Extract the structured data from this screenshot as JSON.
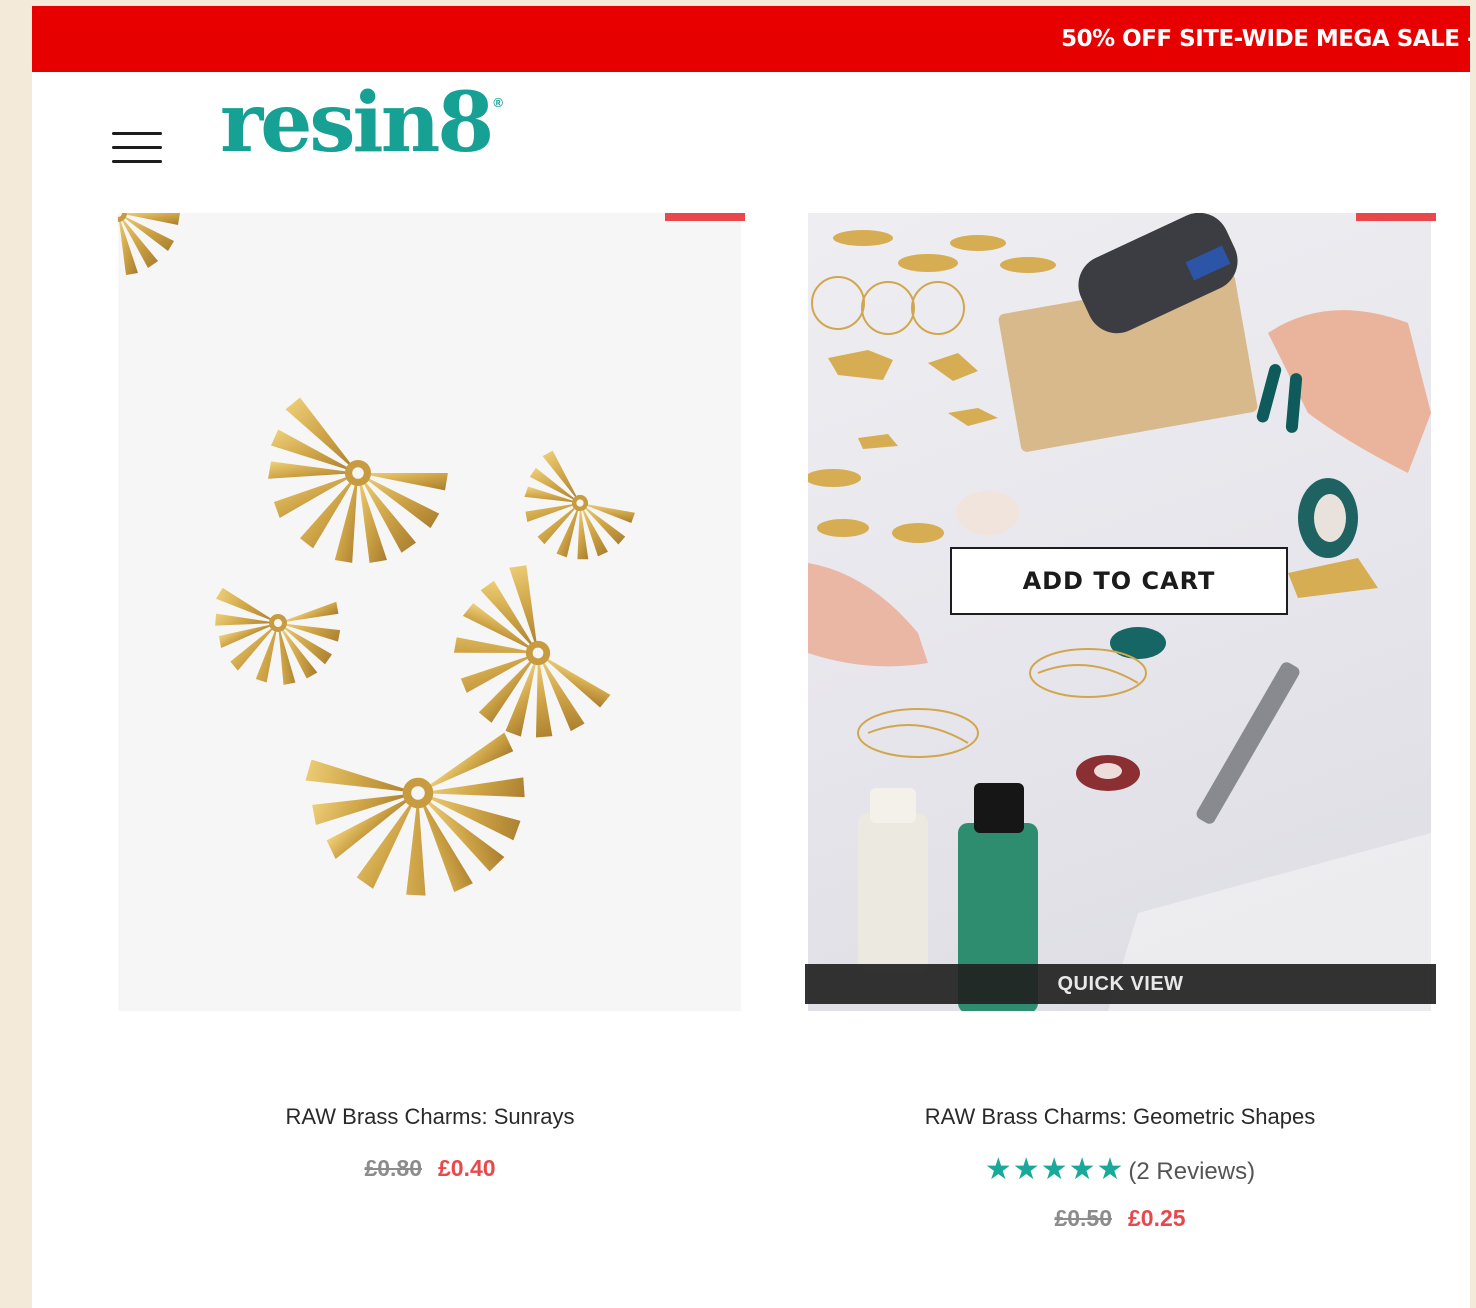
{
  "promo_bar": {
    "text": "50% OFF SITE-WIDE MEGA SALE -"
  },
  "header": {
    "logo_text": "resin8",
    "logo_mark": "®",
    "menu_icon": "hamburger-menu-icon"
  },
  "colors": {
    "promo_red": "#e60000",
    "brand_teal": "#17a195",
    "sale_red": "#e8484c",
    "star_teal": "#18a99b"
  },
  "products": [
    {
      "title": "RAW Brass Charms: Sunrays",
      "old_price": "£0.80",
      "price": "£0.40"
    },
    {
      "title": "RAW Brass Charms: Geometric Shapes",
      "rating_stars": "★★★★★",
      "rating": 5,
      "reviews_label": "(2 Reviews)",
      "old_price": "£0.50",
      "price": "£0.25",
      "add_to_cart_label": "ADD TO CART",
      "quick_view_label": "QUICK VIEW"
    }
  ]
}
